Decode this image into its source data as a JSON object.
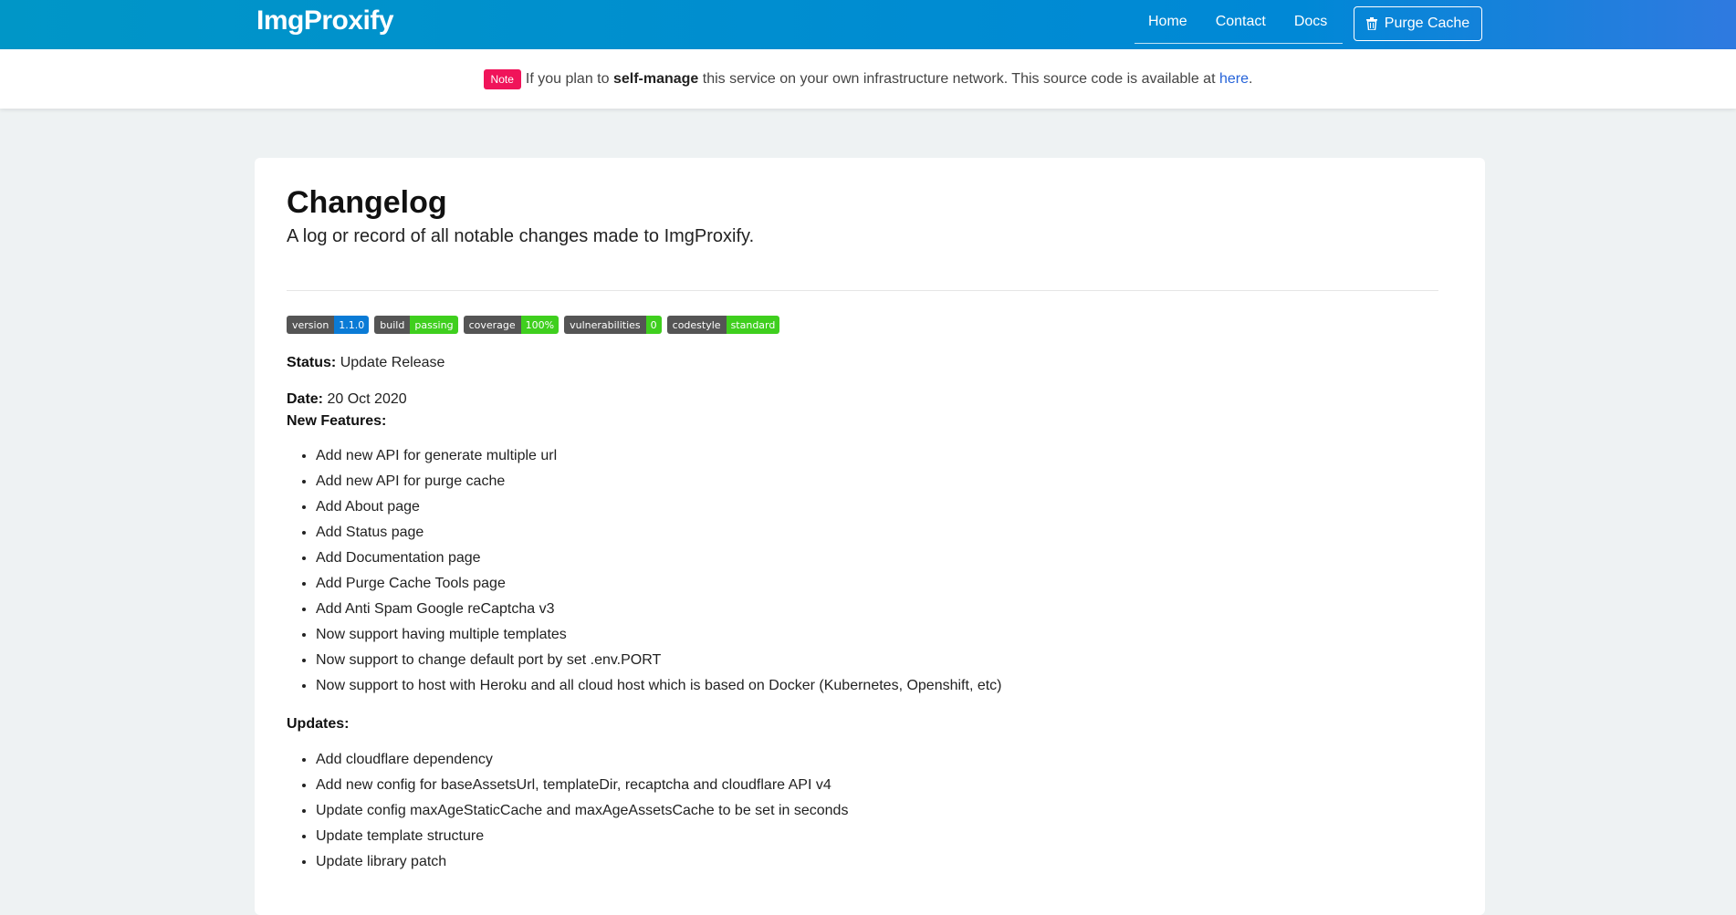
{
  "navbar": {
    "brand": "ImgProxify",
    "links": [
      "Home",
      "Contact",
      "Docs"
    ],
    "purge_label": "Purge Cache"
  },
  "notice": {
    "tag": "Note",
    "text_before": "If you plan to ",
    "bold": "self-manage",
    "text_after": " this service on your own infrastructure network. This source code is available at ",
    "link": "here",
    "end": "."
  },
  "page": {
    "title": "Changelog",
    "subtitle": "A log or record of all notable changes made to ImgProxify."
  },
  "badges": [
    {
      "key": "version",
      "value": "1.1.0",
      "color": "#0a7bd6"
    },
    {
      "key": "build",
      "value": "passing",
      "color": "#3fcf1e"
    },
    {
      "key": "coverage",
      "value": "100%",
      "color": "#3fcf1e"
    },
    {
      "key": "vulnerabilities",
      "value": "0",
      "color": "#3fcf1e"
    },
    {
      "key": "codestyle",
      "value": "standard",
      "color": "#3fcf1e"
    }
  ],
  "release": {
    "status_label": "Status:",
    "status_value": "Update Release",
    "date_label": "Date:",
    "date_value": "20 Oct 2020",
    "features_label": "New Features:",
    "features": [
      "Add new API for generate multiple url",
      "Add new API for purge cache",
      "Add About page",
      "Add Status page",
      "Add Documentation page",
      "Add Purge Cache Tools page",
      "Add Anti Spam Google reCaptcha v3",
      "Now support having multiple templates",
      "Now support to change default port by set .env.PORT",
      "Now support to host with Heroku and all cloud host which is based on Docker (Kubernetes, Openshift, etc)"
    ],
    "updates_label": "Updates:",
    "updates": [
      "Add cloudflare dependency",
      "Add new config for baseAssetsUrl, templateDir, recaptcha and cloudflare API v4",
      "Update config maxAgeStaticCache and maxAgeAssetsCache to be set in seconds",
      "Update template structure",
      "Update library patch"
    ]
  }
}
